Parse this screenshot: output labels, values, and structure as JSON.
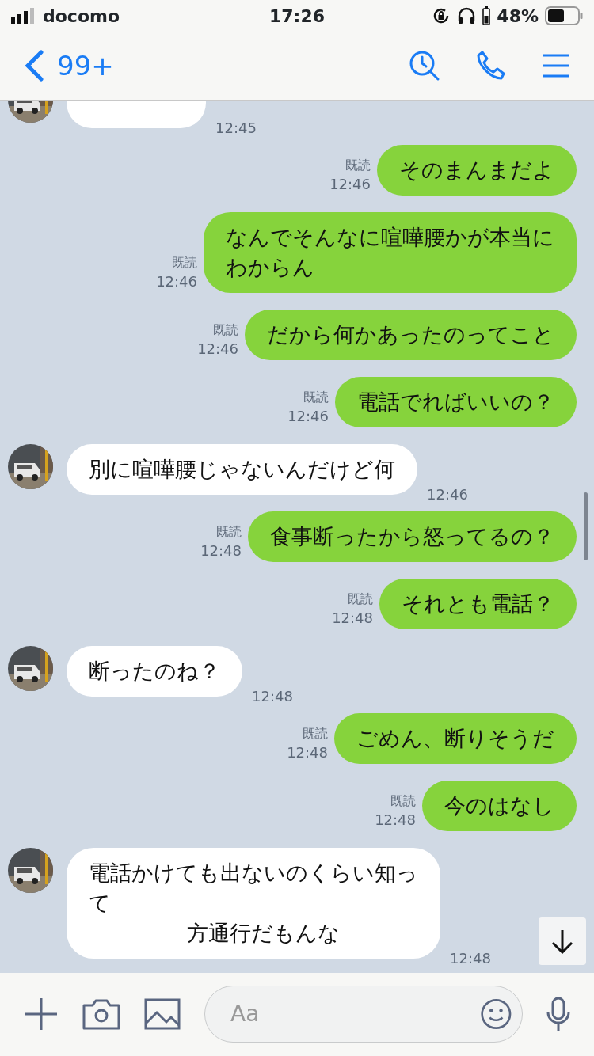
{
  "status_bar": {
    "carrier": "docomo",
    "time": "17:26",
    "battery": "48%"
  },
  "header": {
    "back_label": "99+"
  },
  "messages": [
    {
      "kind": "in",
      "avatar": true,
      "time": "12:45"
    },
    {
      "kind": "out",
      "read_label": "既読",
      "lines": [
        "そのまんまだよ"
      ],
      "time": "12:46"
    },
    {
      "kind": "out",
      "read_label": "既読",
      "lines": [
        "なんでそんなに喧嘩腰かが本当に",
        "わからん"
      ],
      "time": "12:46"
    },
    {
      "kind": "out",
      "read_label": "既読",
      "lines": [
        "だから何かあったのってこと"
      ],
      "time": "12:46"
    },
    {
      "kind": "out",
      "read_label": "既読",
      "lines": [
        "電話でればいいの？"
      ],
      "time": "12:46"
    },
    {
      "kind": "in",
      "avatar": true,
      "lines": [
        "別に喧嘩腰じゃないんだけど何"
      ],
      "time": "12:46"
    },
    {
      "kind": "out",
      "read_label": "既読",
      "lines": [
        "食事断ったから怒ってるの？"
      ],
      "time": "12:48"
    },
    {
      "kind": "out",
      "read_label": "既読",
      "lines": [
        "それとも電話？"
      ],
      "time": "12:48"
    },
    {
      "kind": "in",
      "avatar": true,
      "lines": [
        "断ったのね？"
      ],
      "time": "12:48"
    },
    {
      "kind": "out",
      "read_label": "既読",
      "lines": [
        "ごめん、断りそうだ"
      ],
      "time": "12:48"
    },
    {
      "kind": "out",
      "read_label": "既読",
      "lines": [
        "今のはなし"
      ],
      "time": "12:48"
    },
    {
      "kind": "in",
      "avatar": true,
      "lines": [
        "電話かけても出ないのくらい知っ",
        "て",
        "方通行だもんな"
      ],
      "time": "12:48"
    }
  ],
  "composer": {
    "placeholder": "Aa"
  }
}
